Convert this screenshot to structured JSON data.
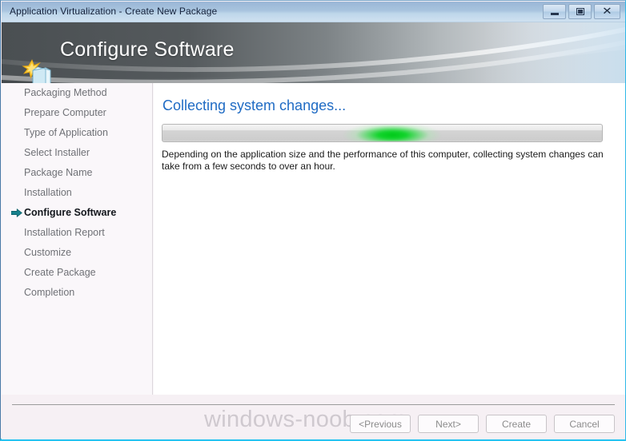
{
  "window": {
    "title": "Application Virtualization - Create New Package",
    "controls": [
      {
        "name": "minimize-button",
        "label": "Minimize"
      },
      {
        "name": "maximize-button",
        "label": "Maximize"
      },
      {
        "name": "close-button",
        "label": "Close"
      }
    ]
  },
  "banner": {
    "title": "Configure Software",
    "icon": "new-package-icon"
  },
  "sidebar": {
    "steps": [
      {
        "label": "Packaging Method",
        "active": false
      },
      {
        "label": "Prepare Computer",
        "active": false
      },
      {
        "label": "Type of Application",
        "active": false
      },
      {
        "label": "Select Installer",
        "active": false
      },
      {
        "label": "Package Name",
        "active": false
      },
      {
        "label": "Installation",
        "active": false
      },
      {
        "label": "Configure Software",
        "active": true
      },
      {
        "label": "Installation Report",
        "active": false
      },
      {
        "label": "Customize",
        "active": false
      },
      {
        "label": "Create Package",
        "active": false
      },
      {
        "label": "Completion",
        "active": false
      }
    ]
  },
  "main": {
    "heading": "Collecting system changes...",
    "description": "Depending on the application size and the performance of this computer, collecting system changes can take from a few seconds to over an hour.",
    "progress": {
      "mode": "indeterminate",
      "marquee_color": "#00c918",
      "track_color": "#d0d0d0"
    }
  },
  "footer": {
    "watermark": "windows-noob.com",
    "buttons": [
      {
        "label": "<Previous",
        "name": "previous-button",
        "disabled": true
      },
      {
        "label": "Next>",
        "name": "next-button",
        "disabled": true
      },
      {
        "label": "Create",
        "name": "create-button",
        "disabled": true
      },
      {
        "label": "Cancel",
        "name": "cancel-button",
        "disabled": true
      }
    ]
  },
  "colors": {
    "titlebar_top": "#9ab6d6",
    "titlebar_bottom": "#cfe0f0",
    "banner_dark": "#4e5356",
    "heading_blue": "#1f6bc4",
    "active_arrow": "#0d7b86",
    "window_border": "#25c3f0"
  }
}
